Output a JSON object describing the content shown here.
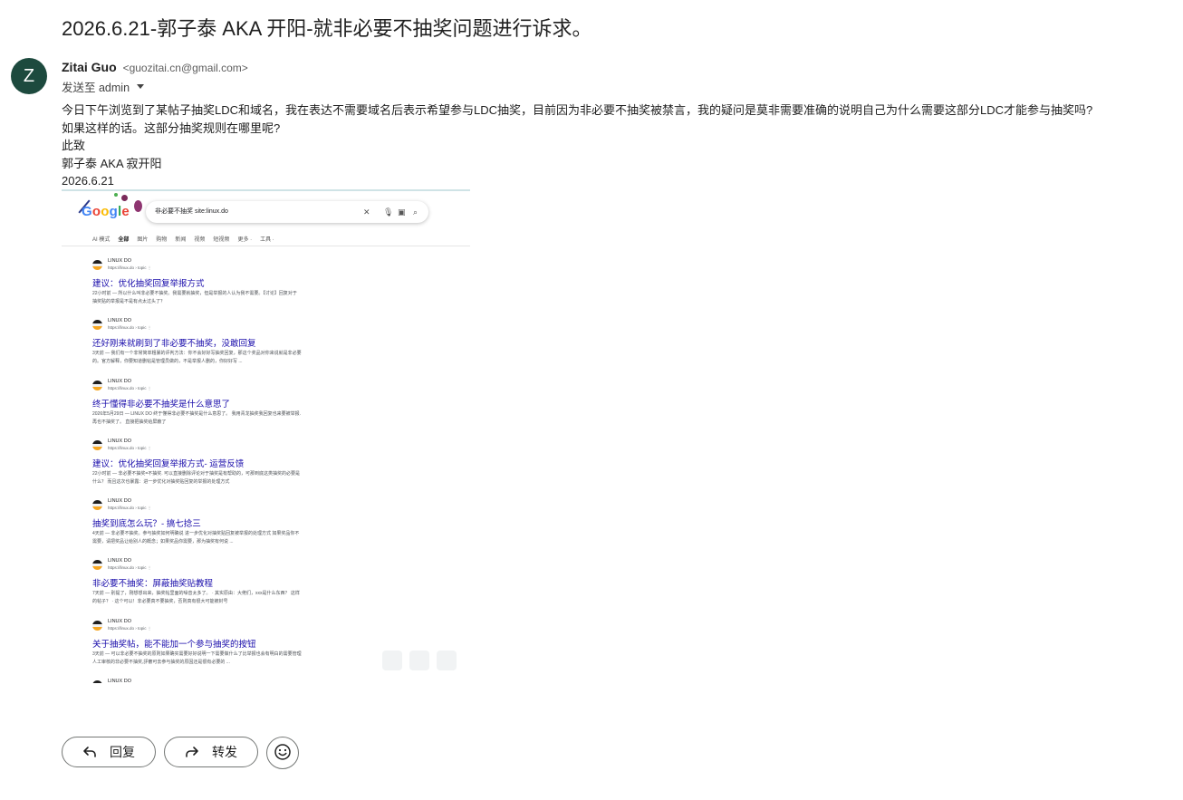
{
  "email": {
    "subject": "2026.6.21-郭子泰 AKA 开阳-就非必要不抽奖问题进行诉求。",
    "sender": {
      "avatar_letter": "Z",
      "avatar_color": "#1d4a3e",
      "name": "Zitai Guo",
      "email": "<guozitai.cn@gmail.com>"
    },
    "recipient_line": "发送至 admin",
    "body_lines": [
      "今日下午浏览到了某帖子抽奖LDC和域名，我在表达不需要域名后表示希望参与LDC抽奖，目前因为非必要不抽奖被禁言，我的疑问是莫非需要准确的说明自己为什么需要这部分LDC才能参与抽奖吗?",
      "如果这样的话。这部分抽奖规则在哪里呢?",
      "此致",
      "郭子泰 AKA 寂开阳",
      "2026.6.21"
    ]
  },
  "attachment_screenshot": {
    "logo": [
      "G",
      "o",
      "o",
      "g",
      "l",
      "e"
    ],
    "query": "非必要不抽奖 site:linux.do",
    "tabs": [
      "AI 模式",
      "全部",
      "图片",
      "购物",
      "新闻",
      "视频",
      "短视频",
      "更多 ·",
      "工具 ·"
    ],
    "active_tab_index": 1,
    "results": [
      {
        "site": "LINUX DO",
        "url": "https://linux.do › topic ⋮",
        "title": "建议：优化抽奖回复举报方式",
        "snippet": [
          "22小时前 — 所以什么叫非必要不抽奖。我需要就抽奖，但是举报的人认为我不需要。【讨论】回复对于",
          "抽奖贴的举报是不是有点太过头了？"
        ]
      },
      {
        "site": "LINUX DO",
        "url": "https://linux.do › topic ⋮",
        "title": "还好刚来就刷到了非必要不抽奖，没敢回复",
        "snippet": [
          "3天前 — 我们有一个非常简单粗暴的评判方法：你不会好好写抽奖回复，那这个奖品对你来说就是非必要",
          "的。官方解释，你要知道删帖是管理员做的，不是举报人删的，你好好写 ..."
        ]
      },
      {
        "site": "LINUX DO",
        "url": "https://linux.do › topic ⋮",
        "title": "终于懂得非必要不抽奖是什么意思了",
        "snippet": [
          "2026年5月29日 — LINUX DO 终于懂得非必要不抽奖是什么意思了。 我用青龙抽奖我回复也来要被举报.",
          "再也不抽奖了。 直接把抽奖给屏蔽了"
        ]
      },
      {
        "site": "LINUX DO",
        "url": "https://linux.do › topic ⋮",
        "title": "建议：优化抽奖回复举报方式- 运营反馈",
        "snippet": [
          "22小时前 — 非必要不抽奖=不抽奖. 可以直接删除评论对于抽奖是有帮助的，可那到底这类抽奖的必要是",
          "什么？ 而且这次也暴露：进一步优化对抽奖贴回复的举报的处理方式"
        ]
      },
      {
        "site": "LINUX DO",
        "url": "https://linux.do › topic ⋮",
        "title": "抽奖到底怎么玩？- 搞七捻三",
        "snippet": [
          "4天前 — 非必要不抽奖。参与抽奖如何明确说 进一步优化对抽奖贴回复被举报的处理方式 如果奖品你不",
          "需要，请把奖品让给别人的概念；如果奖品你需要，那为抽奖有何说 ..."
        ]
      },
      {
        "site": "LINUX DO",
        "url": "https://linux.do › topic ⋮",
        "title": "非必要不抽奖：屏蔽抽奖贴教程",
        "snippet": [
          "7天前 — 别提了，刚想想出来，抽奖帖里面的噪音太多了。 · 其实原由：大佬们，xxx是什么东西？ 这样",
          "的帖子？ · 这个可以！非必要真不要抽奖，否则真有很大可能被封号"
        ]
      },
      {
        "site": "LINUX DO",
        "url": "https://linux.do › topic ⋮",
        "title": "关于抽奖帖，能不能加一个参与抽奖的按钮",
        "snippet": [
          "3天前 — 可以非必要不抽奖的原则如果确实需要好好说明一下需要做什么了比举报也会有明白的需要管理",
          "人工审核的非必要不抽奖,評審可去参与抽奖的原因还是很有必要的 ..."
        ]
      },
      {
        "site": "LINUX DO",
        "url": "",
        "title": "",
        "snippet": []
      }
    ]
  },
  "actions": {
    "reply_label": "回复",
    "forward_label": "转发"
  }
}
